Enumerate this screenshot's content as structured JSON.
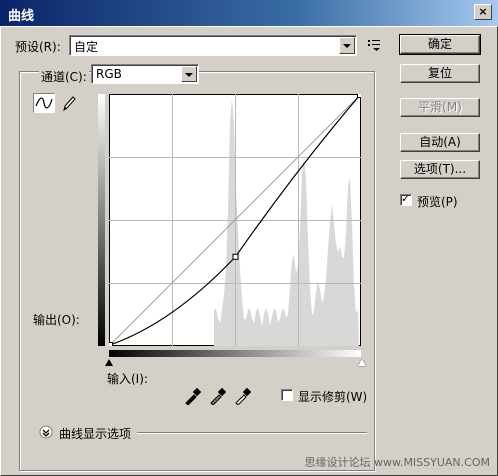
{
  "window": {
    "title": "曲线",
    "close_glyph": "×"
  },
  "preset": {
    "label": "预设(R):",
    "value": "自定"
  },
  "channel": {
    "label": "通道(C):",
    "value": "RGB"
  },
  "output_label": "输出(O):",
  "input_label": "输入(I):",
  "show_clipping": {
    "label": "显示修剪(W)",
    "checked": false
  },
  "curve_display_options": "曲线显示选项",
  "buttons": {
    "ok": "确定",
    "reset": "复位",
    "smooth": "平滑(M)",
    "auto": "自动(A)",
    "options": "选项(T)..."
  },
  "preview": {
    "label": "预览(P)",
    "checked": true
  },
  "watermark": "思缘设计论坛 www.MISSYUAN.COM",
  "colors": {
    "titlebar": "#0a246a",
    "dialog_bg": "#d4d0c8"
  },
  "icons": [
    "curve-tool-icon",
    "pencil-icon",
    "preset-menu-icon",
    "black-eyedropper-icon",
    "gray-eyedropper-icon",
    "white-eyedropper-icon",
    "expand-chevron-icon"
  ],
  "curve": {
    "input_range": [
      0,
      255
    ],
    "output_range": [
      0,
      255
    ],
    "points": [
      [
        0,
        0
      ],
      [
        128,
        90
      ],
      [
        255,
        255
      ]
    ]
  }
}
